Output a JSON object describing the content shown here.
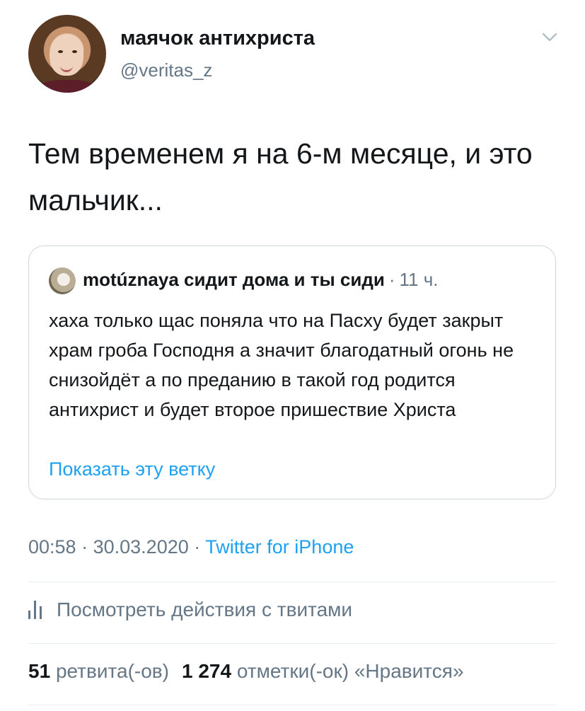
{
  "author": {
    "display_name": "маячок антихриста",
    "handle": "@veritas_z",
    "avatar_icon": "user-avatar"
  },
  "tweet": {
    "text": "Тем временем я на 6-м месяце, и это мальчик..."
  },
  "quoted_tweet": {
    "author_name": "motúznaya сидит дома и ты сиди",
    "separator": "·",
    "time": "11 ч.",
    "text": "хаха только щас поняла что на Пасху будет закрыт храм гроба Господня а значит благодатный огонь не снизойдёт а по преданию в такой год родится антихрист и будет второе пришествие Христа",
    "show_thread": "Показать эту ветку"
  },
  "meta": {
    "time": "00:58",
    "sep1": "·",
    "date": "30.03.2020",
    "sep2": "·",
    "source": "Twitter for iPhone"
  },
  "analytics": {
    "label": "Посмотреть действия с твитами",
    "icon": "bar-chart-icon"
  },
  "stats": {
    "retweets_count": "51",
    "retweets_label": "ретвита(-ов)",
    "likes_count": "1 274",
    "likes_label": "отметки(-ок) «Нравится»"
  },
  "colors": {
    "text": "#14171a",
    "secondary": "#657786",
    "link": "#1da1f2",
    "border": "#ccd6dd"
  }
}
